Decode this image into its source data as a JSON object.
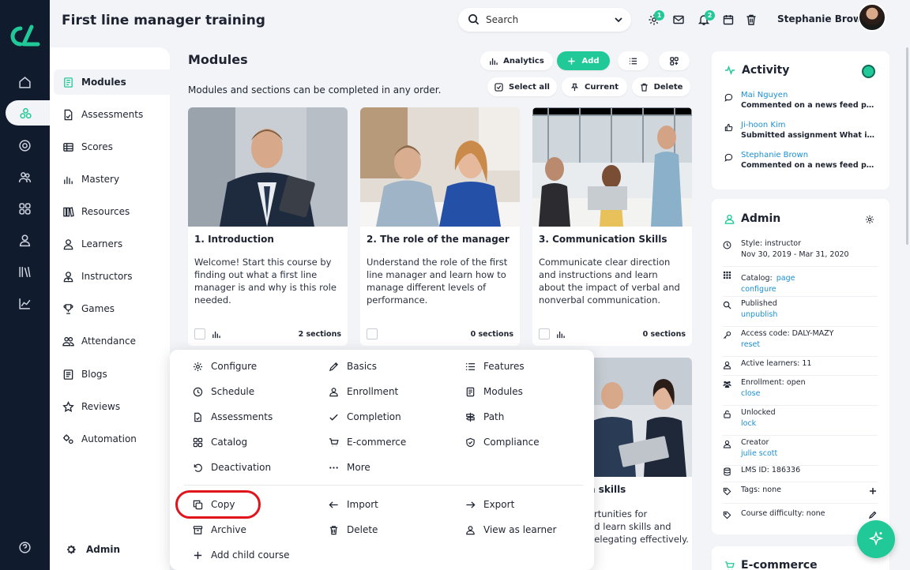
{
  "header": {
    "course_title": "First line manager training",
    "search_placeholder": "Search",
    "settings_badge": "1",
    "notif_badge": "2",
    "user_name": "Stephanie Brown"
  },
  "sidenav": {
    "items": [
      {
        "label": "Modules",
        "icon": "modules-icon"
      },
      {
        "label": "Assessments",
        "icon": "assessments-icon"
      },
      {
        "label": "Scores",
        "icon": "scores-icon"
      },
      {
        "label": "Mastery",
        "icon": "mastery-icon"
      },
      {
        "label": "Resources",
        "icon": "resources-icon"
      },
      {
        "label": "Learners",
        "icon": "learners-icon"
      },
      {
        "label": "Instructors",
        "icon": "instructors-icon"
      },
      {
        "label": "Games",
        "icon": "games-icon"
      },
      {
        "label": "Attendance",
        "icon": "attendance-icon"
      },
      {
        "label": "Blogs",
        "icon": "blogs-icon"
      },
      {
        "label": "Reviews",
        "icon": "reviews-icon"
      },
      {
        "label": "Automation",
        "icon": "automation-icon"
      }
    ],
    "footer": "Admin"
  },
  "main": {
    "title": "Modules",
    "subtitle": "Modules and sections can be completed in any order.",
    "toolbar": {
      "analytics": "Analytics",
      "add": "Add",
      "select_all": "Select all",
      "current": "Current",
      "delete": "Delete"
    },
    "cards": [
      {
        "title": "1. Introduction",
        "desc": "Welcome! Start this course by finding out what a first line manager is and why is this role needed.",
        "sections": "2 sections"
      },
      {
        "title": "2. The role of the manager",
        "desc": "Understand the role of the first line manager and learn how to manage different levels of performance.",
        "sections": "0 sections"
      },
      {
        "title": "3. Communication Skills",
        "desc": "Communicate clear direction and instructions and learn about the impact of verbal and nonverbal communication.",
        "sections": "0 sections"
      }
    ],
    "card4": {
      "title_fragment": "n skills",
      "desc_lines": [
        "ortunities for",
        "nd learn skills and",
        "delegating effectively."
      ]
    }
  },
  "menu": {
    "items": [
      {
        "label": "Configure",
        "icon": "gear-icon"
      },
      {
        "label": "Basics",
        "icon": "pencil-icon"
      },
      {
        "label": "Features",
        "icon": "list-icon"
      },
      {
        "label": "Schedule",
        "icon": "clock-icon"
      },
      {
        "label": "Enrollment",
        "icon": "person-icon"
      },
      {
        "label": "Modules",
        "icon": "book-icon"
      },
      {
        "label": "Assessments",
        "icon": "file-icon"
      },
      {
        "label": "Completion",
        "icon": "check-icon"
      },
      {
        "label": "Path",
        "icon": "signpost-icon"
      },
      {
        "label": "Catalog",
        "icon": "grid-icon"
      },
      {
        "label": "E-commerce",
        "icon": "cart-icon"
      },
      {
        "label": "Compliance",
        "icon": "shield-icon"
      },
      {
        "label": "Deactivation",
        "icon": "undo-icon"
      },
      {
        "label": "More",
        "icon": "dots-icon"
      },
      {
        "label": "Copy",
        "icon": "copy-icon"
      },
      {
        "label": "Import",
        "icon": "arrow-left-icon"
      },
      {
        "label": "Export",
        "icon": "arrow-right-icon"
      },
      {
        "label": "Archive",
        "icon": "archive-icon"
      },
      {
        "label": "Delete",
        "icon": "trash-icon"
      },
      {
        "label": "View as learner",
        "icon": "person-icon"
      },
      {
        "label": "Add child course",
        "icon": "plus-icon"
      }
    ]
  },
  "activity": {
    "title": "Activity",
    "items": [
      {
        "name": "Mai Nguyen",
        "desc": "Commented on a news feed post"
      },
      {
        "name": "Ji-hoon Kim",
        "desc": "Submitted assignment What is the ..."
      },
      {
        "name": "Stephanie Brown",
        "desc": "Commented on a news feed post"
      }
    ]
  },
  "admin": {
    "title": "Admin",
    "style_label": "Style: instructor",
    "style_dates": "Nov 30, 2019 - Mar 31, 2020",
    "catalog_label": "Catalog:",
    "catalog_link1": "page",
    "catalog_link2": "configure",
    "published_label": "Published",
    "published_link": "unpublish",
    "access_label": "Access code: DALY-MAZY",
    "access_link": "reset",
    "learners_label": "Active learners: 11",
    "enroll_label": "Enrollment: open",
    "enroll_link": "close",
    "unlocked_label": "Unlocked",
    "unlocked_link": "lock",
    "creator_label": "Creator",
    "creator_link": "julie scott",
    "lms_label": "LMS ID: 186336",
    "tags_label": "Tags: none",
    "difficulty_label": "Course difficulty: none"
  },
  "ecommerce": {
    "title": "E-commerce"
  },
  "colors": {
    "accent": "#20c997",
    "rail": "#111b2e",
    "link": "#1b8fd1",
    "highlight": "#e1141c"
  }
}
